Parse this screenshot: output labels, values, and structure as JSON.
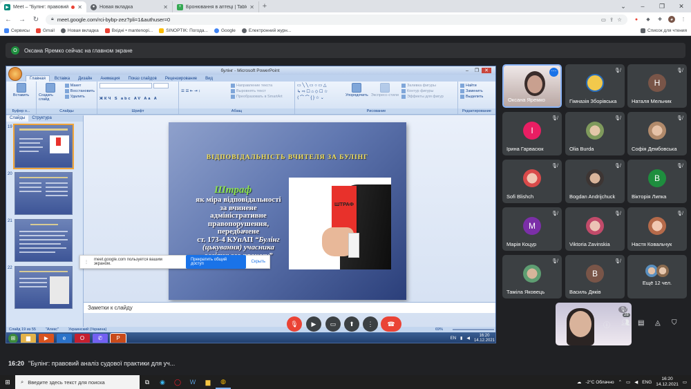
{
  "browser": {
    "tabs": [
      {
        "label": "Meet – \"Булінг: правовий ан",
        "color": "#00897b",
        "active": true
      },
      {
        "label": "Новая вкладка",
        "color": "#5f6368",
        "active": false
      },
      {
        "label": "Бронювання в аптеці | Tabletki",
        "color": "#34a853",
        "active": false
      }
    ],
    "new_tab": "+",
    "url": "meet.google.com/rci-bybp-zez?pli=1&authuser=0",
    "bookmarks": [
      {
        "label": "Сервисы",
        "color": "#4285f4"
      },
      {
        "label": "Gmail",
        "color": "#ea4335"
      },
      {
        "label": "Новая вкладка",
        "color": "#5f6368"
      },
      {
        "label": "Вхідні • mantenopi...",
        "color": "#ea4335"
      },
      {
        "label": "SINOPTIK: Погода...",
        "color": "#fbbc04"
      },
      {
        "label": "Google",
        "color": "#4285f4"
      },
      {
        "label": "Електронний журн...",
        "color": "#5f6368"
      }
    ],
    "reading_list": "Список для чтения"
  },
  "meet": {
    "presenter_initial": "О",
    "presenter_banner": "Оксана Яремко сейчас на главном экране",
    "time": "16:20",
    "title": "\"Булінг: правовий аналіз судової практики для уч...",
    "participant_count": "28",
    "participants": [
      {
        "name": "Оксана Яремко",
        "type": "video",
        "color": "#6b5a53"
      },
      {
        "name": "Гімназія Зборівська",
        "type": "logo",
        "color": "#f2c94c"
      },
      {
        "name": "Наталя Мельник",
        "type": "letter",
        "letter": "Н",
        "color": "#795548"
      },
      {
        "name": "Ірина Гарвасюк",
        "type": "letter",
        "letter": "І",
        "color": "#e91e63"
      },
      {
        "name": "Olia Burda",
        "type": "photo",
        "color": "#b7c9a0"
      },
      {
        "name": "Софія Дембовська",
        "type": "photo",
        "color": "#d7b9a4"
      },
      {
        "name": "Sofi Blishch",
        "type": "photo",
        "color": "#e05a5a"
      },
      {
        "name": "Bogdan Andrijchuck",
        "type": "photo",
        "color": "#8a7a6e"
      },
      {
        "name": "Вікторія Липка",
        "type": "letter",
        "letter": "В",
        "color": "#1e8e3e"
      },
      {
        "name": "Марія Коцур",
        "type": "letter",
        "letter": "М",
        "color": "#7b2fa8"
      },
      {
        "name": "Viktoria Zavinskia",
        "type": "photo",
        "color": "#c98a8a"
      },
      {
        "name": "Настя Ковальчук",
        "type": "photo",
        "color": "#d39a7a"
      },
      {
        "name": "Таміла Яковець",
        "type": "photo",
        "color": "#6f9e78"
      },
      {
        "name": "Василь Дяків",
        "type": "letter",
        "letter": "В",
        "color": "#795548"
      },
      {
        "name": "Ещё 12 чел.",
        "type": "more",
        "color": "#5a8fbf"
      }
    ]
  },
  "powerpoint": {
    "window_title": "булінг - Microsoft PowerPoint",
    "tabs": [
      "Главная",
      "Вставка",
      "Дизайн",
      "Анимация",
      "Показ слайдов",
      "Рецензирование",
      "Вид"
    ],
    "groups": [
      "Буфер о...",
      "Слайды",
      "Шрифт",
      "Абзац",
      "Рисование",
      "Редактирование"
    ],
    "buttons": {
      "paste": "Вставить",
      "new_slide": "Создать слайд",
      "layout": "Макет",
      "reset": "Восстановить",
      "delete": "Удалить",
      "text_direction": "Направление текста",
      "align_text": "Выровнять текст",
      "smartart": "Преобразовать в SmartArt",
      "arrange": "Упорядочить",
      "quick_styles": "Экспресс-стили",
      "shape_fill": "Заливка фигуры",
      "shape_outline": "Контур фигуры",
      "shape_effects": "Эффекты для фигур",
      "find": "Найти",
      "replace": "Заменить",
      "select": "Выделить"
    },
    "left_tabs": [
      "Слайды",
      "Структура"
    ],
    "slide_numbers": [
      "19",
      "20",
      "21",
      "22"
    ],
    "slide": {
      "heading": "ВІДПОВІДАЛЬНІСТЬ  ВЧИТЕЛЯ  ЗА  БУЛІНГ",
      "word": "Штраф",
      "body_lines": [
        "як міра відповідальності",
        "за вчинене",
        "адміністративне",
        "правопорушення,",
        "передбачене",
        "ст. 173-4 КУпАП"
      ],
      "quote_lines": [
        "“Булінг",
        "(цькування) учасника",
        "освітнього процесу”"
      ],
      "card_label": "ШТРАФ"
    },
    "notes_placeholder": "Заметки к слайду",
    "status": {
      "slide_counter": "Слайд 19 из 55",
      "theme": "\"Алекс\"",
      "language": "Украинский (Украина)",
      "zoom": "69%"
    },
    "inner_taskbar": {
      "lang": "EN",
      "time": "16:20",
      "date": "14.12.2021"
    }
  },
  "share_bar": {
    "message": "meet.google.com пользуется вашим экраном.",
    "stop_label": "Прекратить общий доступ",
    "hide_label": "Скрыть"
  },
  "taskbar": {
    "search_placeholder": "Введите здесь текст для поиска",
    "weather": "-2°C  Облачно",
    "lang": "ENG",
    "time": "16:20",
    "date": "14.12.2021"
  }
}
